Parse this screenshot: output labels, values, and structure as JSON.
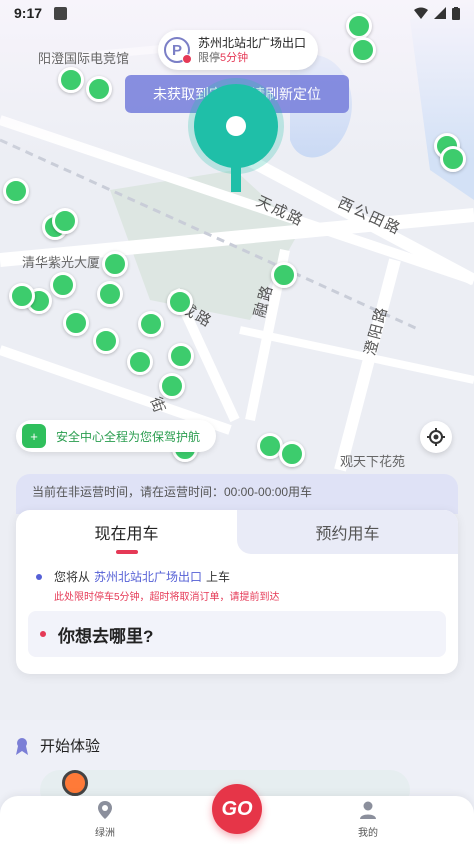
{
  "status_bar": {
    "time": "9:17"
  },
  "map": {
    "labels": {
      "building": "阳澄国际电竞馆",
      "tower": "清华紫光大厦",
      "garden": "观天下花苑",
      "road_tiancheng": "天成路",
      "road_xigongtian": "西公田路",
      "road_rongge": "融路",
      "road_chengyang": "澄阳路",
      "road_chengpart": "成路",
      "road_jie": "街"
    },
    "parking": {
      "name": "苏州北站北广场出口",
      "limit_prefix": "限停",
      "limit_value": "5分钟",
      "icon": "parking-icon"
    },
    "toast": "未获取到定位，请刷新定位",
    "safety_badge": "安全中心全程为您保驾护航",
    "colors": {
      "vehicle": "#3dcc6d",
      "location_pin": "#1fbfa8",
      "accent": "#e53956",
      "primary": "#5560d6"
    }
  },
  "notice": "当前在非运营时间，请在运营时间：00:00-00:00用车",
  "booking": {
    "tabs": [
      {
        "label": "现在用车"
      },
      {
        "label": "预约用车"
      }
    ],
    "pickup_prefix": "您将从",
    "pickup_station": "苏州北站北广场出口",
    "pickup_suffix": "上车",
    "pickup_warning": "此处限时停车5分钟，超时将取消订单，请提前到达",
    "destination_placeholder": "你想去哪里?"
  },
  "start_section": {
    "title": "开始体验"
  },
  "bottom_nav": {
    "left": {
      "label": "绿洲",
      "icon": "map-pin-icon"
    },
    "center": {
      "label": "GO"
    },
    "right": {
      "label": "我的",
      "icon": "user-icon"
    }
  }
}
